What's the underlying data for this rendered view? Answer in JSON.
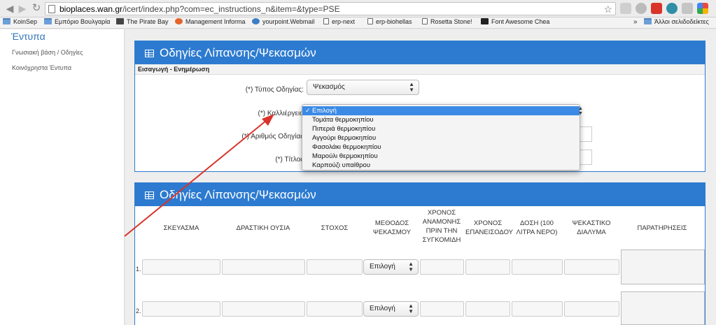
{
  "browser": {
    "url_host": "bioplaces.wan.gr",
    "url_path": "/icert/index.php?com=ec_instructions_n&item=&type=PSE",
    "bookmarks": [
      {
        "label": "KoinSep",
        "icon": "folder"
      },
      {
        "label": "Εμπόριο Βουλγαρία",
        "icon": "folder"
      },
      {
        "label": "The Pirate Bay",
        "icon": "fav"
      },
      {
        "label": "Management Informa",
        "icon": "orange"
      },
      {
        "label": "yourpoint.Webmail",
        "icon": "blueball"
      },
      {
        "label": "erp-next",
        "icon": "doc"
      },
      {
        "label": "erp-biohellas",
        "icon": "doc"
      },
      {
        "label": "Rosetta Stone!",
        "icon": "doc"
      },
      {
        "label": "Font Awesome Chea",
        "icon": "dark"
      }
    ],
    "more": "»",
    "other_bookmarks": "Άλλοι σελιδοδείκτες"
  },
  "sidebar": {
    "heading": "Έντυπα",
    "links": [
      "Γνωσιακή βάση / Οδηγίες",
      "Κοινόχρηστα Έντυπα"
    ]
  },
  "form_panel": {
    "title": "Οδηγίες Λίπανσης/Ψεκασμών",
    "subtitle": "Εισαγωγή - Ενημέρωση",
    "type_label": "(*) Τύπος Οδηγίας:",
    "type_value": "Ψεκασμός",
    "crop_label": "(*) Καλλιέργεια",
    "number_label": "(*) Αριθμός Οδηγίας",
    "title_label": "(*) Τίτλος"
  },
  "crop_dropdown": {
    "options": [
      "Επιλογή",
      "Τομάτα θερμοκηπίου",
      "Πιπεριά θερμοκηπίου",
      "Αγγούρι θερμοκηπίου",
      "Φασολάκι θερμοκηπίου",
      "Μαρούλι θερμοκηπίου",
      "Καρπούζι υπαίθρου"
    ],
    "selected_index": 0,
    "check": "✓"
  },
  "table_panel": {
    "title": "Οδηγίες Λίπανσης/Ψεκασμών",
    "headers": [
      "ΣΚΕΥΑΣΜΑ",
      "ΔΡΑΣΤΙΚΗ ΟΥΣΙΑ",
      "ΣΤΟΧΟΣ",
      "ΜΕΘΟΔΟΣ ΨΕΚΑΣΜΟΥ",
      "ΧΡΟΝΟΣ ΑΝΑΜΟΝΗΣ ΠΡΙΝ ΤΗΝ ΣΥΓΚΟΜΙΔΗ",
      "ΧΡΟΝΟΣ ΕΠΑΝΕΙΣΟΔΟΥ",
      "ΔΟΣΗ (100 ΛΙΤΡΑ ΝΕΡΟ)",
      "ΨΕΚΑΣΤΙΚΟ ΔΙΑΛΥΜΑ",
      "ΠΑΡΑΤΗΡΗΣΕΙΣ"
    ],
    "rows": [
      {
        "num": "1.",
        "method": "Επιλογή"
      },
      {
        "num": "2.",
        "method": "Επιλογή"
      }
    ]
  },
  "colors": {
    "accent": "#2d7bd0",
    "annotation_arrow": "#d9342b",
    "selected_option": "#3b8ae6"
  }
}
